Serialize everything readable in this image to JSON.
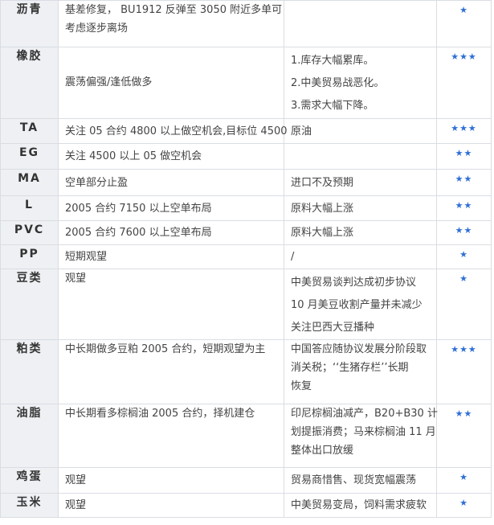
{
  "rows": [
    {
      "category": "沥青",
      "strategy": [
        "基差修复， BU1912 反弹至 3050 附近多单可",
        "考虑逐步离场"
      ],
      "logic": [],
      "stars": "★"
    },
    {
      "category": "橡胶",
      "strategy": [
        "震荡偏强/逢低做多"
      ],
      "logic": [
        "1.库存大幅累库。",
        "2.中美贸易战恶化。",
        "3.需求大幅下降。"
      ],
      "stars": "★★★"
    },
    {
      "category": "TA",
      "strategy": [
        "关注 05 合约 4800 以上做空机会,目标位 4500"
      ],
      "logic": [
        "原油"
      ],
      "stars": "★★★"
    },
    {
      "category": "EG",
      "strategy": [
        "关注 4500 以上 05 做空机会"
      ],
      "logic": [],
      "stars": "★★"
    },
    {
      "category": "MA",
      "strategy": [
        "空单部分止盈"
      ],
      "logic": [
        "进口不及预期"
      ],
      "stars": "★★"
    },
    {
      "category": "L",
      "strategy": [
        "2005 合约 7150 以上空单布局"
      ],
      "logic": [
        "原料大幅上涨"
      ],
      "stars": "★★"
    },
    {
      "category": "PVC",
      "strategy": [
        "2005 合约 7600 以上空单布局"
      ],
      "logic": [
        "原料大幅上涨"
      ],
      "stars": "★★"
    },
    {
      "category": "PP",
      "strategy": [
        "短期观望"
      ],
      "logic": [
        "/"
      ],
      "stars": "★"
    },
    {
      "category": "豆类",
      "strategy": [
        "观望"
      ],
      "logic": [
        "中美贸易谈判达成初步协议",
        "10 月美豆收割产量并未减少",
        "关注巴西大豆播种"
      ],
      "stars": "★"
    },
    {
      "category": "粕类",
      "strategy": [
        "中长期做多豆粕 2005 合约，短期观望为主"
      ],
      "logic": [
        "中国答应随协议发展分阶段取",
        "消关税；‘‘生猪存栏’’长期",
        "恢复"
      ],
      "stars": "★★★"
    },
    {
      "category": "油脂",
      "strategy": [
        "中长期看多棕榈油 2005 合约，择机建仓"
      ],
      "logic": [
        "印尼棕榈油减产，B20+B30 计",
        "划提振消费；马来棕榈油 11 月",
        "整体出口放缓"
      ],
      "stars": "★★"
    },
    {
      "category": "鸡蛋",
      "strategy": [
        "观望"
      ],
      "logic": [
        "贸易商惜售、现货宽幅震荡"
      ],
      "stars": "★"
    },
    {
      "category": "玉米",
      "strategy": [
        "观望"
      ],
      "logic": [
        "中美贸易变局，饲料需求疲软"
      ],
      "stars": "★"
    }
  ]
}
